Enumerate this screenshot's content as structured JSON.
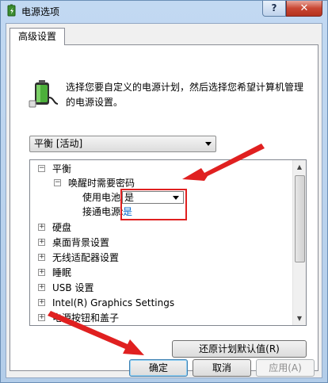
{
  "window": {
    "title": "电源选项",
    "help_label": "?",
    "close_label": "✕"
  },
  "tab": {
    "label": "高级设置"
  },
  "description": "选择您要自定义的电源计划，然后选择您希望计算机管理的电源设置。",
  "plan_select": {
    "value": "平衡 [活动]"
  },
  "tree": {
    "items": [
      {
        "label": "平衡",
        "expander": "−"
      },
      {
        "label": "唤醒时需要密码",
        "expander": "−"
      },
      {
        "label": "使用电池:",
        "value": "是"
      },
      {
        "label": "接通电源:",
        "value": "是"
      },
      {
        "label": "硬盘",
        "expander": "+"
      },
      {
        "label": "桌面背景设置",
        "expander": "+"
      },
      {
        "label": "无线适配器设置",
        "expander": "+"
      },
      {
        "label": "睡眠",
        "expander": "+"
      },
      {
        "label": "USB 设置",
        "expander": "+"
      },
      {
        "label": "Intel(R) Graphics Settings",
        "expander": "+"
      },
      {
        "label": "电源按钮和盖子",
        "expander": "+"
      }
    ]
  },
  "buttons": {
    "restore": "还原计划默认值(R)",
    "ok": "确定",
    "cancel": "取消",
    "apply": "应用(A)"
  },
  "colors": {
    "annotation_red": "#e02020",
    "link_blue": "#0066cc"
  }
}
